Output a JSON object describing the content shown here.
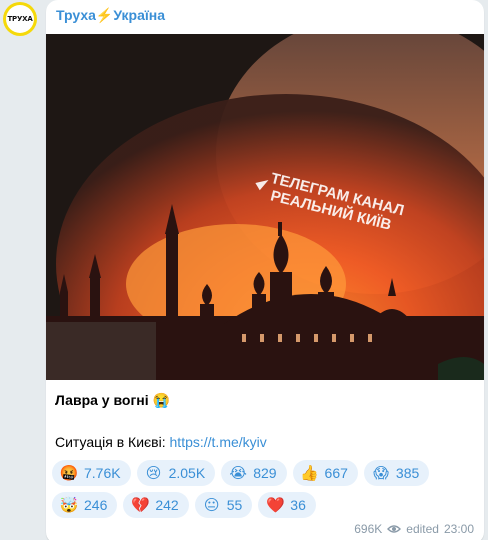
{
  "channel": {
    "name": "Труха⚡Україна",
    "avatar_text": "ТРУХА",
    "avatar_color": "#f5d90a"
  },
  "media": {
    "watermark_line1": "ТЕЛЕГРАМ КАНАЛ",
    "watermark_line2": "РЕАЛЬНИЙ КИЇВ"
  },
  "message": {
    "title": "Лавра у вогні 😭",
    "line_prefix": "Ситуація в Києві: ",
    "link_text": "https://t.me/kyiv"
  },
  "reactions": [
    {
      "emoji": "🤬",
      "icon": "enraged-face-icon",
      "count": "7.76K"
    },
    {
      "emoji": "😢",
      "icon": "crying-face-icon",
      "count": "2.05K"
    },
    {
      "emoji": "😭",
      "icon": "loudly-crying-face-icon",
      "count": "829"
    },
    {
      "emoji": "👍",
      "icon": "thumbs-up-icon",
      "count": "667"
    },
    {
      "emoji": "😱",
      "icon": "screaming-face-icon",
      "count": "385"
    },
    {
      "emoji": "🤯",
      "icon": "exploding-head-icon",
      "count": "246"
    },
    {
      "emoji": "💔",
      "icon": "broken-heart-icon",
      "count": "242"
    },
    {
      "emoji": "😐",
      "icon": "neutral-face-icon",
      "count": "55"
    },
    {
      "emoji": "❤️",
      "icon": "red-heart-icon",
      "count": "36"
    }
  ],
  "footer": {
    "views": "696K",
    "edited_label": "edited",
    "time": "23:00"
  },
  "colors": {
    "link": "#3a8fd6",
    "reaction_bg": "#e7f1fb",
    "meta": "#8a9aa8",
    "background": "#e6ebee"
  }
}
